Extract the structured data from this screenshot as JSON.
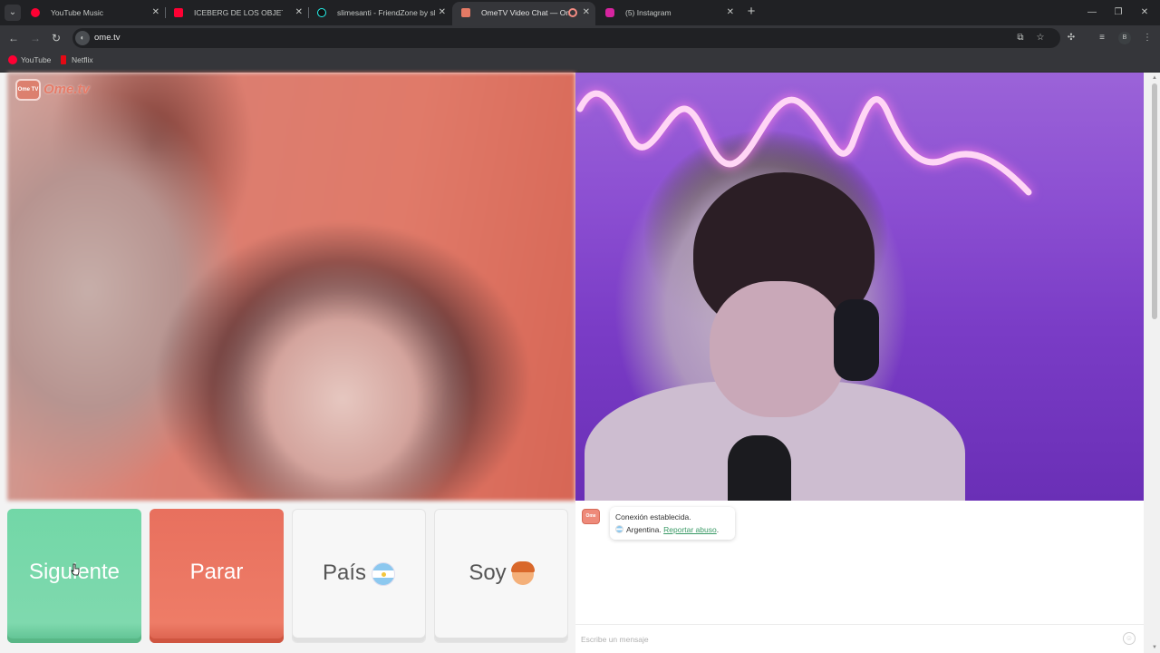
{
  "browser": {
    "tabs": [
      {
        "title": "YouTube Music",
        "favicon_color": "#ff0033"
      },
      {
        "title": "ICEBERG DE LOS OBJETOS PERDIDOS",
        "favicon_color": "#ff0033"
      },
      {
        "title": "slimesanti - FriendZone by slimesanti",
        "favicon_color": "#111111"
      },
      {
        "title": "OmeTV Video Chat — OmeTV",
        "favicon_color": "#e57a65"
      },
      {
        "title": "(5) Instagram",
        "favicon_color": "#d6249f"
      }
    ],
    "active_tab_index": 3,
    "url": "ome.tv",
    "bookmarks": [
      {
        "label": "YouTube",
        "favicon_color": "#ff0033"
      },
      {
        "label": "Netflix",
        "favicon_color": "#e50914"
      }
    ],
    "profile_initial": "B"
  },
  "logo": {
    "text": "Ome.tv",
    "badge": "Ome TV"
  },
  "controls": {
    "next_label": "Siguiente",
    "stop_label": "Parar",
    "country_label": "País",
    "gender_label": "Soy"
  },
  "chat": {
    "avatar_text": "Ome TV",
    "status_message": "Conexión establecida.",
    "country": "Argentina.",
    "report_link": "Reportar abuso",
    "report_suffix": ".",
    "input_placeholder": "Escribe un mensaje"
  },
  "colors": {
    "next_button": "#72d7a7",
    "stop_button": "#e8705e",
    "link_green": "#3a9a66"
  }
}
